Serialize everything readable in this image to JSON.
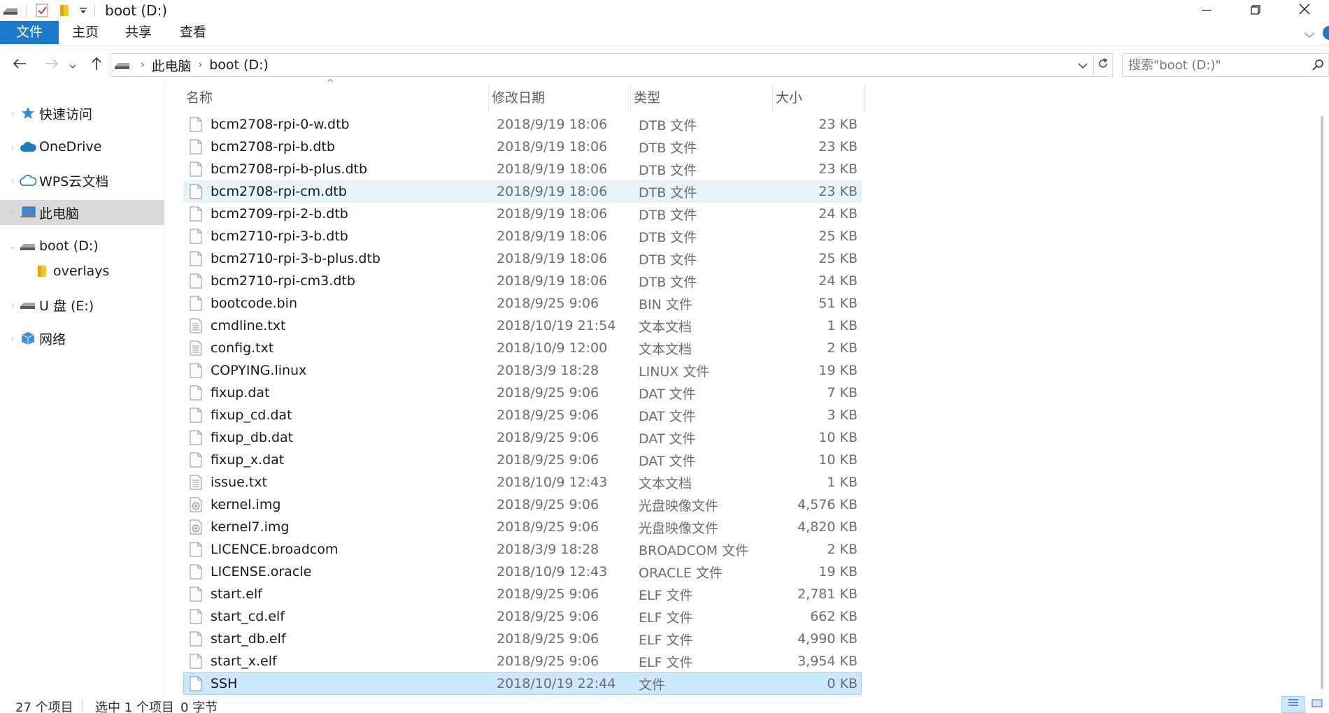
{
  "window": {
    "title": "boot (D:)"
  },
  "ribbon": {
    "tabs": [
      "文件",
      "主页",
      "共享",
      "查看"
    ]
  },
  "address": {
    "crumbs": [
      "此电脑",
      "boot (D:)"
    ]
  },
  "search": {
    "placeholder": "搜索\"boot (D:)\""
  },
  "sidebar": {
    "items": [
      {
        "label": "快速访问",
        "icon": "star-icon"
      },
      {
        "label": "OneDrive",
        "icon": "cloud-icon"
      },
      {
        "label": "WPS云文档",
        "icon": "cloud-outline-icon"
      },
      {
        "label": "此电脑",
        "icon": "computer-icon"
      },
      {
        "label": "boot (D:)",
        "icon": "drive-icon"
      },
      {
        "label": "overlays",
        "icon": "folder-icon"
      },
      {
        "label": "U 盘 (E:)",
        "icon": "drive-icon"
      },
      {
        "label": "网络",
        "icon": "network-icon"
      }
    ]
  },
  "columns": {
    "name": "名称",
    "date": "修改日期",
    "type": "类型",
    "size": "大小"
  },
  "files": [
    {
      "name": "bcm2708-rpi-0-w.dtb",
      "date": "2018/9/19 18:06",
      "type": "DTB 文件",
      "size": "23 KB",
      "icon": "file-icon"
    },
    {
      "name": "bcm2708-rpi-b.dtb",
      "date": "2018/9/19 18:06",
      "type": "DTB 文件",
      "size": "23 KB",
      "icon": "file-icon"
    },
    {
      "name": "bcm2708-rpi-b-plus.dtb",
      "date": "2018/9/19 18:06",
      "type": "DTB 文件",
      "size": "23 KB",
      "icon": "file-icon"
    },
    {
      "name": "bcm2708-rpi-cm.dtb",
      "date": "2018/9/19 18:06",
      "type": "DTB 文件",
      "size": "23 KB",
      "icon": "file-icon"
    },
    {
      "name": "bcm2709-rpi-2-b.dtb",
      "date": "2018/9/19 18:06",
      "type": "DTB 文件",
      "size": "24 KB",
      "icon": "file-icon"
    },
    {
      "name": "bcm2710-rpi-3-b.dtb",
      "date": "2018/9/19 18:06",
      "type": "DTB 文件",
      "size": "25 KB",
      "icon": "file-icon"
    },
    {
      "name": "bcm2710-rpi-3-b-plus.dtb",
      "date": "2018/9/19 18:06",
      "type": "DTB 文件",
      "size": "25 KB",
      "icon": "file-icon"
    },
    {
      "name": "bcm2710-rpi-cm3.dtb",
      "date": "2018/9/19 18:06",
      "type": "DTB 文件",
      "size": "24 KB",
      "icon": "file-icon"
    },
    {
      "name": "bootcode.bin",
      "date": "2018/9/25 9:06",
      "type": "BIN 文件",
      "size": "51 KB",
      "icon": "file-icon"
    },
    {
      "name": "cmdline.txt",
      "date": "2018/10/19 21:54",
      "type": "文本文档",
      "size": "1 KB",
      "icon": "text-file-icon"
    },
    {
      "name": "config.txt",
      "date": "2018/10/9 12:00",
      "type": "文本文档",
      "size": "2 KB",
      "icon": "text-file-icon"
    },
    {
      "name": "COPYING.linux",
      "date": "2018/3/9 18:28",
      "type": "LINUX 文件",
      "size": "19 KB",
      "icon": "file-icon"
    },
    {
      "name": "fixup.dat",
      "date": "2018/9/25 9:06",
      "type": "DAT 文件",
      "size": "7 KB",
      "icon": "file-icon"
    },
    {
      "name": "fixup_cd.dat",
      "date": "2018/9/25 9:06",
      "type": "DAT 文件",
      "size": "3 KB",
      "icon": "file-icon"
    },
    {
      "name": "fixup_db.dat",
      "date": "2018/9/25 9:06",
      "type": "DAT 文件",
      "size": "10 KB",
      "icon": "file-icon"
    },
    {
      "name": "fixup_x.dat",
      "date": "2018/9/25 9:06",
      "type": "DAT 文件",
      "size": "10 KB",
      "icon": "file-icon"
    },
    {
      "name": "issue.txt",
      "date": "2018/10/9 12:43",
      "type": "文本文档",
      "size": "1 KB",
      "icon": "text-file-icon"
    },
    {
      "name": "kernel.img",
      "date": "2018/9/25 9:06",
      "type": "光盘映像文件",
      "size": "4,576 KB",
      "icon": "disc-image-icon"
    },
    {
      "name": "kernel7.img",
      "date": "2018/9/25 9:06",
      "type": "光盘映像文件",
      "size": "4,820 KB",
      "icon": "disc-image-icon"
    },
    {
      "name": "LICENCE.broadcom",
      "date": "2018/3/9 18:28",
      "type": "BROADCOM 文件",
      "size": "2 KB",
      "icon": "file-icon"
    },
    {
      "name": "LICENSE.oracle",
      "date": "2018/10/9 12:43",
      "type": "ORACLE 文件",
      "size": "19 KB",
      "icon": "file-icon"
    },
    {
      "name": "start.elf",
      "date": "2018/9/25 9:06",
      "type": "ELF 文件",
      "size": "2,781 KB",
      "icon": "file-icon"
    },
    {
      "name": "start_cd.elf",
      "date": "2018/9/25 9:06",
      "type": "ELF 文件",
      "size": "662 KB",
      "icon": "file-icon"
    },
    {
      "name": "start_db.elf",
      "date": "2018/9/25 9:06",
      "type": "ELF 文件",
      "size": "4,990 KB",
      "icon": "file-icon"
    },
    {
      "name": "start_x.elf",
      "date": "2018/9/25 9:06",
      "type": "ELF 文件",
      "size": "3,954 KB",
      "icon": "file-icon"
    },
    {
      "name": "SSH",
      "date": "2018/10/19 22:44",
      "type": "文件",
      "size": "0 KB",
      "icon": "file-icon"
    }
  ],
  "status": {
    "count": "27 个项目",
    "selection": "选中 1 个项目",
    "selection_size": "0 字节"
  },
  "colors": {
    "accent": "#1979ca",
    "selected_row": "#cce8ff",
    "hover_row": "#e5f3fb",
    "header_text": "#4c607a"
  }
}
